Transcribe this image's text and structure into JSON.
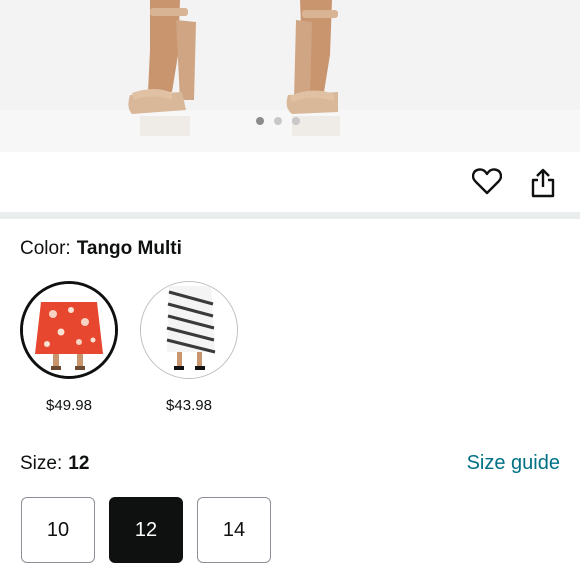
{
  "product_image": {
    "carousel_dots": 3,
    "active_dot": 1
  },
  "actions": {
    "favorite_icon": "heart-icon",
    "share_icon": "share-icon"
  },
  "color": {
    "label": "Color:",
    "selected": "Tango Multi",
    "options": [
      {
        "name": "Tango Multi",
        "price": "$49.98",
        "selected": true
      },
      {
        "name": "Stripe",
        "price": "$43.98",
        "selected": false
      }
    ]
  },
  "size": {
    "label": "Size:",
    "selected": "12",
    "guide_label": "Size guide",
    "options": [
      "10",
      "12",
      "14"
    ]
  },
  "colors": {
    "link": "#007185",
    "text": "#0f1111",
    "selected_bg": "#0f1111",
    "floral_red": "#e8472f"
  }
}
